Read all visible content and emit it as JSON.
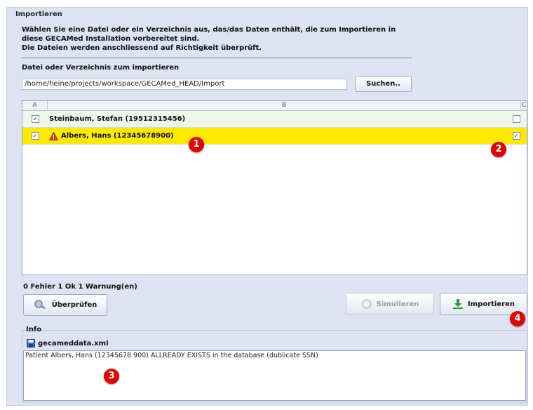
{
  "panel": {
    "title": "Importieren"
  },
  "description": {
    "line1": "Wählen Sie eine Datei oder ein Verzeichnis aus, das/das Daten enthält, die zum Importieren in",
    "line2": "diese GECAMed Installation vorbereitet sind.",
    "line3": "Die Dateien werden anschliessend auf Richtigkeit überprüft."
  },
  "path": {
    "label": "Datei oder Verzeichnis zum importieren",
    "value": "/home/heine/projects/workspace/GECAMed_HEAD/Import",
    "browse_label": "Suchen.."
  },
  "table": {
    "headers": [
      "A",
      "B",
      "C"
    ],
    "rows": [
      {
        "check_a": "✓",
        "name": "Steinbaum, Stefan (19512315456)",
        "check_c": "",
        "warning": false
      },
      {
        "check_a": "✓",
        "name": "Albers, Hans (12345678900)",
        "check_c": "✓",
        "warning": true
      }
    ]
  },
  "status": "0 Fehler  1 Ok  1 Warnung(en)",
  "buttons": {
    "check_label": "Überprüfen",
    "simulate_label": "Simulieren",
    "import_label": "Importieren"
  },
  "info": {
    "label": "Info",
    "filename": "gecameddata.xml",
    "message": "Patient Albers, Hans (12345678 900) ALLREADY EXISTS in the database (dublicate SSN)"
  },
  "markers": [
    "1",
    "2",
    "3",
    "4"
  ],
  "colors": {
    "warning_row": "#ffe900",
    "ok_row": "#eef7ea",
    "marker": "#e00000",
    "panel": "#dde3f2"
  }
}
